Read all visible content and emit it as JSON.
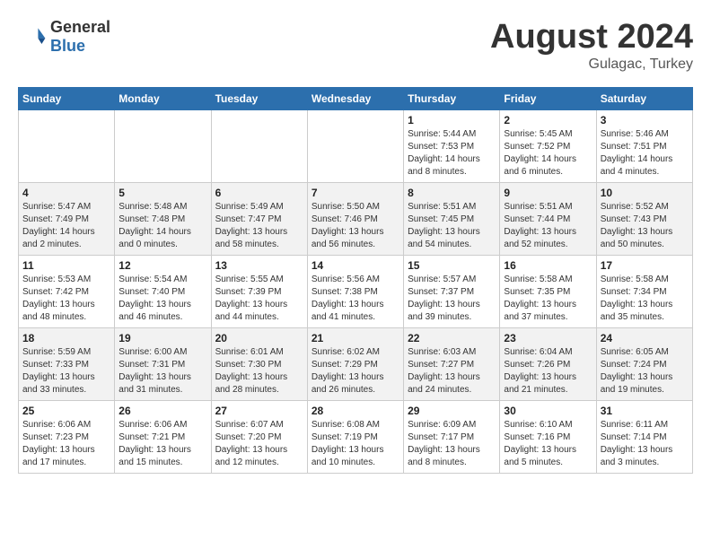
{
  "header": {
    "logo_general": "General",
    "logo_blue": "Blue",
    "month_title": "August 2024",
    "location": "Gulagac, Turkey"
  },
  "days_of_week": [
    "Sunday",
    "Monday",
    "Tuesday",
    "Wednesday",
    "Thursday",
    "Friday",
    "Saturday"
  ],
  "weeks": [
    [
      {
        "day": "",
        "info": ""
      },
      {
        "day": "",
        "info": ""
      },
      {
        "day": "",
        "info": ""
      },
      {
        "day": "",
        "info": ""
      },
      {
        "day": "1",
        "info": "Sunrise: 5:44 AM\nSunset: 7:53 PM\nDaylight: 14 hours\nand 8 minutes."
      },
      {
        "day": "2",
        "info": "Sunrise: 5:45 AM\nSunset: 7:52 PM\nDaylight: 14 hours\nand 6 minutes."
      },
      {
        "day": "3",
        "info": "Sunrise: 5:46 AM\nSunset: 7:51 PM\nDaylight: 14 hours\nand 4 minutes."
      }
    ],
    [
      {
        "day": "4",
        "info": "Sunrise: 5:47 AM\nSunset: 7:49 PM\nDaylight: 14 hours\nand 2 minutes."
      },
      {
        "day": "5",
        "info": "Sunrise: 5:48 AM\nSunset: 7:48 PM\nDaylight: 14 hours\nand 0 minutes."
      },
      {
        "day": "6",
        "info": "Sunrise: 5:49 AM\nSunset: 7:47 PM\nDaylight: 13 hours\nand 58 minutes."
      },
      {
        "day": "7",
        "info": "Sunrise: 5:50 AM\nSunset: 7:46 PM\nDaylight: 13 hours\nand 56 minutes."
      },
      {
        "day": "8",
        "info": "Sunrise: 5:51 AM\nSunset: 7:45 PM\nDaylight: 13 hours\nand 54 minutes."
      },
      {
        "day": "9",
        "info": "Sunrise: 5:51 AM\nSunset: 7:44 PM\nDaylight: 13 hours\nand 52 minutes."
      },
      {
        "day": "10",
        "info": "Sunrise: 5:52 AM\nSunset: 7:43 PM\nDaylight: 13 hours\nand 50 minutes."
      }
    ],
    [
      {
        "day": "11",
        "info": "Sunrise: 5:53 AM\nSunset: 7:42 PM\nDaylight: 13 hours\nand 48 minutes."
      },
      {
        "day": "12",
        "info": "Sunrise: 5:54 AM\nSunset: 7:40 PM\nDaylight: 13 hours\nand 46 minutes."
      },
      {
        "day": "13",
        "info": "Sunrise: 5:55 AM\nSunset: 7:39 PM\nDaylight: 13 hours\nand 44 minutes."
      },
      {
        "day": "14",
        "info": "Sunrise: 5:56 AM\nSunset: 7:38 PM\nDaylight: 13 hours\nand 41 minutes."
      },
      {
        "day": "15",
        "info": "Sunrise: 5:57 AM\nSunset: 7:37 PM\nDaylight: 13 hours\nand 39 minutes."
      },
      {
        "day": "16",
        "info": "Sunrise: 5:58 AM\nSunset: 7:35 PM\nDaylight: 13 hours\nand 37 minutes."
      },
      {
        "day": "17",
        "info": "Sunrise: 5:58 AM\nSunset: 7:34 PM\nDaylight: 13 hours\nand 35 minutes."
      }
    ],
    [
      {
        "day": "18",
        "info": "Sunrise: 5:59 AM\nSunset: 7:33 PM\nDaylight: 13 hours\nand 33 minutes."
      },
      {
        "day": "19",
        "info": "Sunrise: 6:00 AM\nSunset: 7:31 PM\nDaylight: 13 hours\nand 31 minutes."
      },
      {
        "day": "20",
        "info": "Sunrise: 6:01 AM\nSunset: 7:30 PM\nDaylight: 13 hours\nand 28 minutes."
      },
      {
        "day": "21",
        "info": "Sunrise: 6:02 AM\nSunset: 7:29 PM\nDaylight: 13 hours\nand 26 minutes."
      },
      {
        "day": "22",
        "info": "Sunrise: 6:03 AM\nSunset: 7:27 PM\nDaylight: 13 hours\nand 24 minutes."
      },
      {
        "day": "23",
        "info": "Sunrise: 6:04 AM\nSunset: 7:26 PM\nDaylight: 13 hours\nand 21 minutes."
      },
      {
        "day": "24",
        "info": "Sunrise: 6:05 AM\nSunset: 7:24 PM\nDaylight: 13 hours\nand 19 minutes."
      }
    ],
    [
      {
        "day": "25",
        "info": "Sunrise: 6:06 AM\nSunset: 7:23 PM\nDaylight: 13 hours\nand 17 minutes."
      },
      {
        "day": "26",
        "info": "Sunrise: 6:06 AM\nSunset: 7:21 PM\nDaylight: 13 hours\nand 15 minutes."
      },
      {
        "day": "27",
        "info": "Sunrise: 6:07 AM\nSunset: 7:20 PM\nDaylight: 13 hours\nand 12 minutes."
      },
      {
        "day": "28",
        "info": "Sunrise: 6:08 AM\nSunset: 7:19 PM\nDaylight: 13 hours\nand 10 minutes."
      },
      {
        "day": "29",
        "info": "Sunrise: 6:09 AM\nSunset: 7:17 PM\nDaylight: 13 hours\nand 8 minutes."
      },
      {
        "day": "30",
        "info": "Sunrise: 6:10 AM\nSunset: 7:16 PM\nDaylight: 13 hours\nand 5 minutes."
      },
      {
        "day": "31",
        "info": "Sunrise: 6:11 AM\nSunset: 7:14 PM\nDaylight: 13 hours\nand 3 minutes."
      }
    ]
  ]
}
